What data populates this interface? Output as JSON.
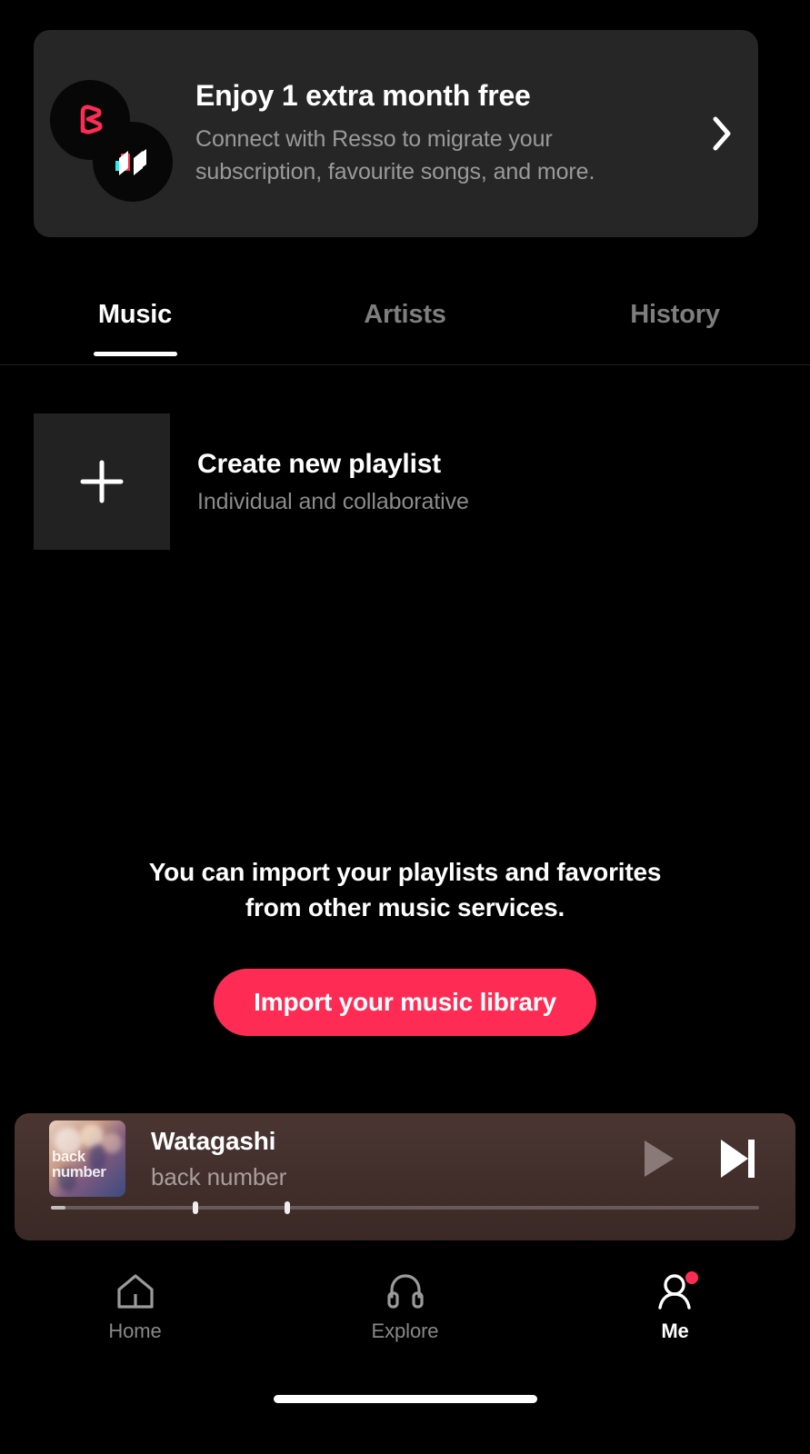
{
  "banner": {
    "title": "Enjoy 1 extra month free",
    "subtitle": "Connect with Resso to migrate your subscription, favourite songs, and more.",
    "chevron_icon": "chevron-right-icon",
    "resso_logo_icon": "resso-logo-icon",
    "tiktok_logo_icon": "tiktok-music-logo-icon"
  },
  "tabs": [
    {
      "label": "Music",
      "active": true
    },
    {
      "label": "Artists",
      "active": false
    },
    {
      "label": "History",
      "active": false
    }
  ],
  "create_playlist": {
    "title": "Create new playlist",
    "subtitle": "Individual and collaborative",
    "icon": "plus-icon"
  },
  "import": {
    "message": "You can import your playlists and favorites from other music services.",
    "button_label": "Import your music library",
    "button_color": "#fe2c55"
  },
  "player": {
    "title": "Watagashi",
    "artist": "back number",
    "album_art_text": "back\nnumber",
    "play_icon": "play-icon",
    "next_icon": "skip-next-icon",
    "progress_percent": 2,
    "marker_positions": [
      20,
      33
    ]
  },
  "bottom_nav": [
    {
      "label": "Home",
      "icon": "home-icon",
      "active": false,
      "badge": false
    },
    {
      "label": "Explore",
      "icon": "headphones-icon",
      "active": false,
      "badge": false
    },
    {
      "label": "Me",
      "icon": "person-icon",
      "active": true,
      "badge": true
    }
  ],
  "colors": {
    "background": "#000000",
    "banner_bg": "#262626",
    "accent": "#fe2c55",
    "player_bg": "#44312e",
    "muted_text": "#8b8b8b"
  }
}
